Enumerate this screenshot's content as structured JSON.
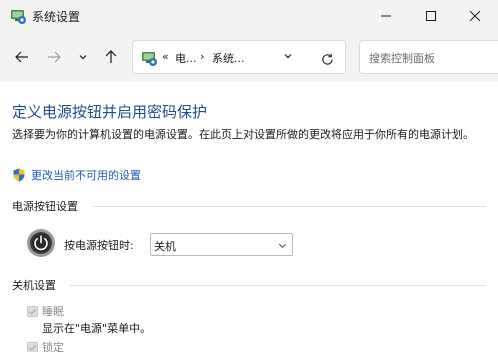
{
  "window": {
    "title": "系统设置"
  },
  "nav": {
    "breadcrumb_prefix": "«",
    "breadcrumb_1": "电...",
    "breadcrumb_sep": "›",
    "breadcrumb_2": "系统...",
    "search_placeholder": "搜索控制面板"
  },
  "page": {
    "title": "定义电源按钮并启用密码保护",
    "description": "选择要为你的计算机设置的电源设置。在此页上对设置所做的更改将应用于你所有的电源计划。",
    "change_link": "更改当前不可用的设置"
  },
  "power_button_section": {
    "header": "电源按钮设置",
    "label": "按电源按钮时:",
    "selected_value": "关机"
  },
  "shutdown_section": {
    "header": "关机设置",
    "items": [
      {
        "label": "睡眠",
        "subtext": "显示在\"电源\"菜单中。",
        "checked": true,
        "disabled": true
      },
      {
        "label": "锁定",
        "checked": true,
        "disabled": true
      }
    ]
  },
  "colors": {
    "title_blue": "#1e4e8c",
    "link_blue": "#1e5ab4",
    "chrome_bg": "#f3f3f3"
  }
}
